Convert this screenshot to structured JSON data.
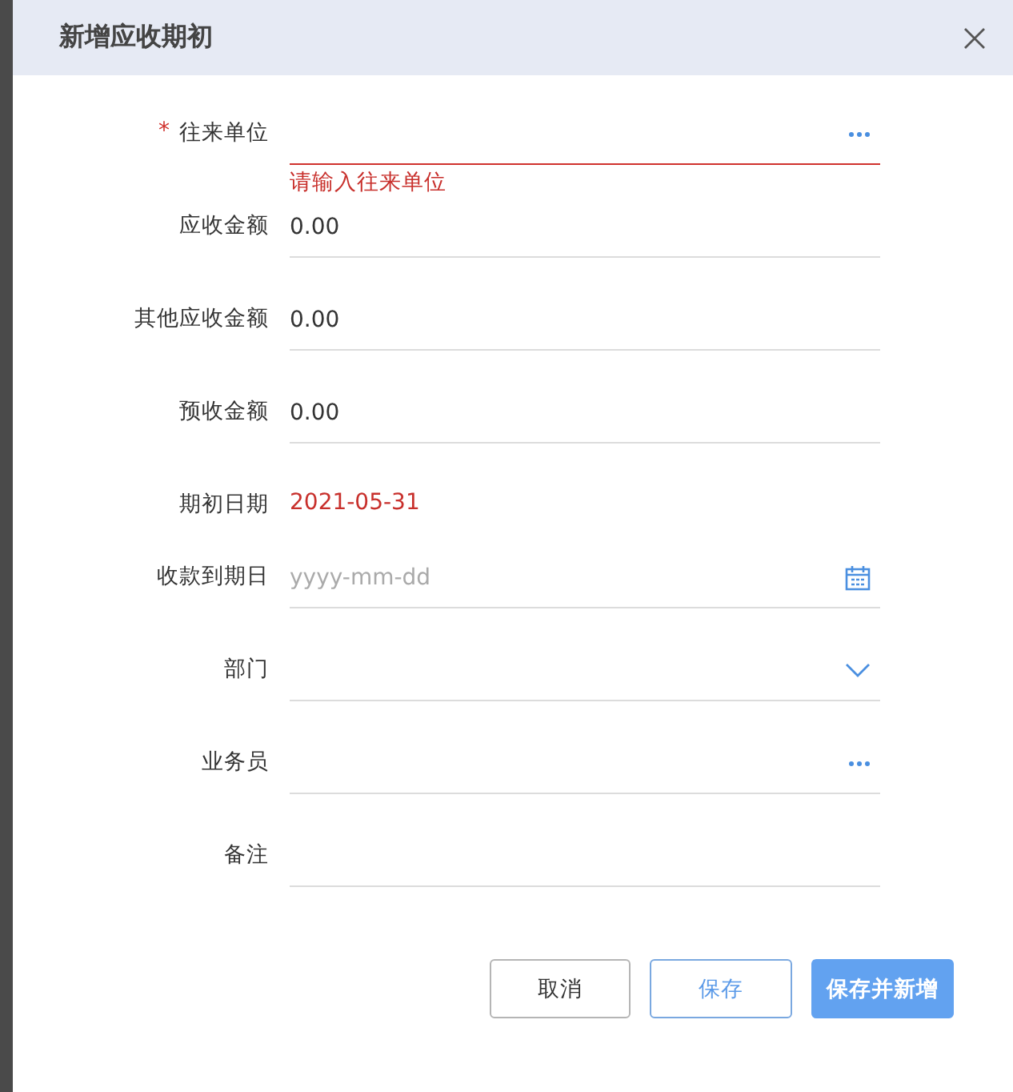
{
  "dialog": {
    "title": "新增应收期初"
  },
  "fields": [
    {
      "kind": "lookup",
      "label": "往来单位",
      "required_mark": "*",
      "error": "请输入往来单位"
    },
    {
      "kind": "text",
      "label": "应收金额",
      "value": "0.00"
    },
    {
      "kind": "text",
      "label": "其他应收金额",
      "value": "0.00"
    },
    {
      "kind": "text",
      "label": "预收金额",
      "value": "0.00"
    },
    {
      "kind": "readonly",
      "label": "期初日期",
      "value": "2021-05-31"
    },
    {
      "kind": "date",
      "label": "收款到期日",
      "placeholder": "yyyy-mm-dd"
    },
    {
      "kind": "select",
      "label": "部门"
    },
    {
      "kind": "lookup",
      "label": "业务员"
    },
    {
      "kind": "text",
      "label": "备注"
    }
  ],
  "buttons": [
    {
      "label": "取消",
      "kind": "default"
    },
    {
      "label": "保存",
      "kind": "outline"
    },
    {
      "label": "保存并新增",
      "kind": "primary"
    }
  ]
}
